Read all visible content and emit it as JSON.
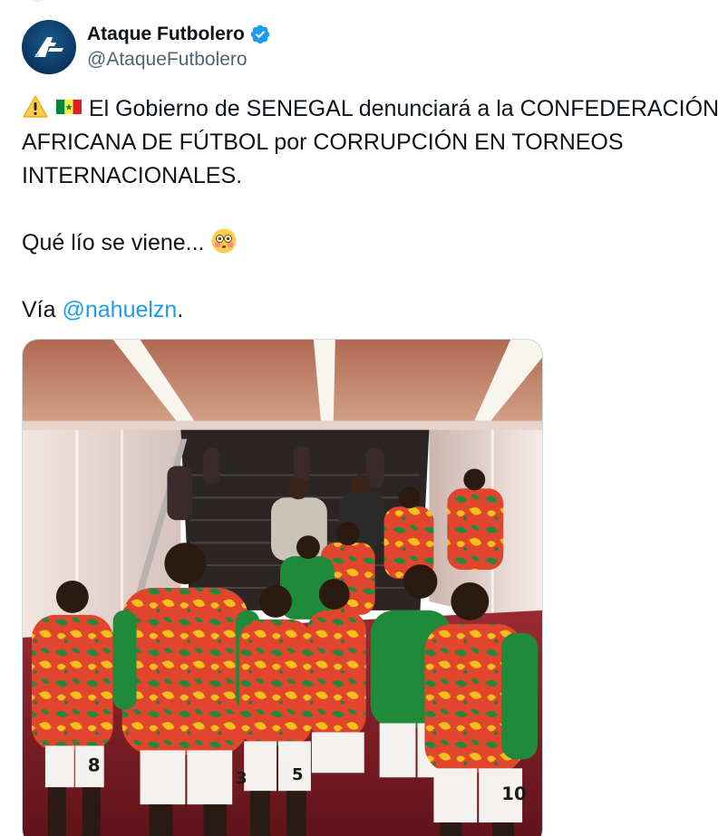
{
  "author": {
    "display_name": "Ataque Futbolero",
    "handle": "@AtaqueFutbolero",
    "verified": true,
    "avatar_icon": "ataque-futbolero-logo"
  },
  "tweet": {
    "line1_emojis": [
      "warning-emoji",
      "senegal-flag-emoji"
    ],
    "paragraph1": "El Gobierno de SENEGAL denunciará a la CONFEDERACIÓN AFRICANA DE FÚTBOL por CORRUPCIÓN EN TORNEOS INTERNACIONALES.",
    "paragraph2": "Qué lío se viene...",
    "paragraph2_emoji": "flushed-face-emoji",
    "via_prefix": "Vía ",
    "via_mention": "@nahuelzn",
    "via_suffix": "."
  },
  "media": {
    "type": "photo",
    "description_icon": "photo-senegal-team-tunnel",
    "jersey_numbers": [
      "8",
      "3",
      "5",
      "10"
    ]
  },
  "colors": {
    "link": "#1d9bf0",
    "verified": "#1d9bf0",
    "text": "#0f1419",
    "secondary": "#536471",
    "avatar_bg": "#0c3a66"
  }
}
